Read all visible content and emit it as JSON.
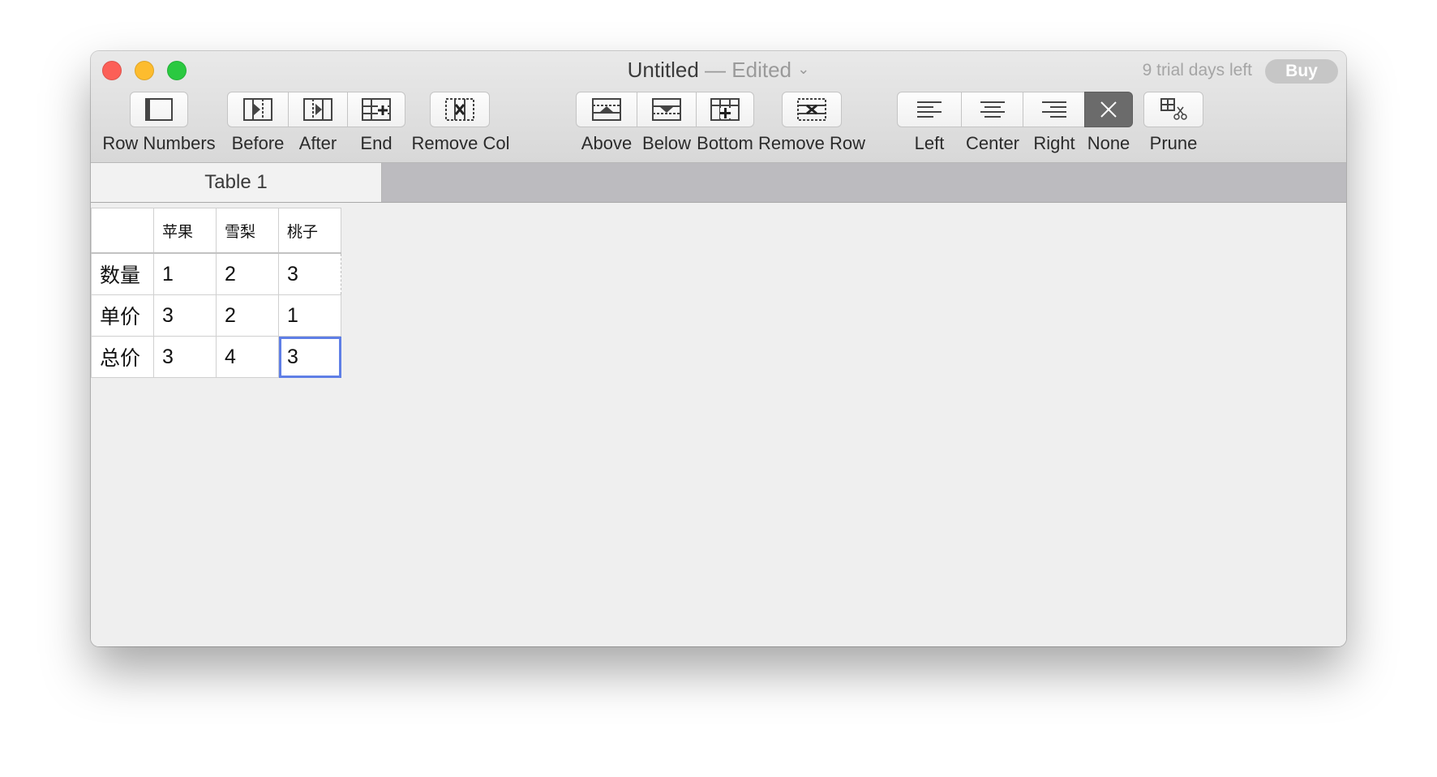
{
  "window": {
    "title": "Untitled",
    "edited": "— Edited",
    "trial_text": "9 trial days left",
    "buy_label": "Buy"
  },
  "toolbar": {
    "row_numbers": "Row Numbers",
    "before": "Before",
    "after": "After",
    "end": "End",
    "remove_col": "Remove Col",
    "above": "Above",
    "below": "Below",
    "bottom": "Bottom",
    "remove_row": "Remove Row",
    "left": "Left",
    "center": "Center",
    "right": "Right",
    "none": "None",
    "prune": "Prune",
    "active_alignment": "None"
  },
  "tabs": [
    {
      "label": "Table 1",
      "selected": true
    }
  ],
  "table": {
    "headers": [
      "",
      "苹果",
      "雪梨",
      "桃子"
    ],
    "rows": [
      {
        "label": "数量",
        "cells": [
          "1",
          "2",
          "3"
        ]
      },
      {
        "label": "单价",
        "cells": [
          "3",
          "2",
          "1"
        ]
      },
      {
        "label": "总价",
        "cells": [
          "3",
          "4",
          "3"
        ]
      }
    ],
    "selected_cell": {
      "row": 2,
      "col": 2
    }
  },
  "colors": {
    "selection": "#5f7fe6",
    "close": "#fc5f57",
    "minimize": "#fdbc2e",
    "zoom": "#2ac940"
  }
}
